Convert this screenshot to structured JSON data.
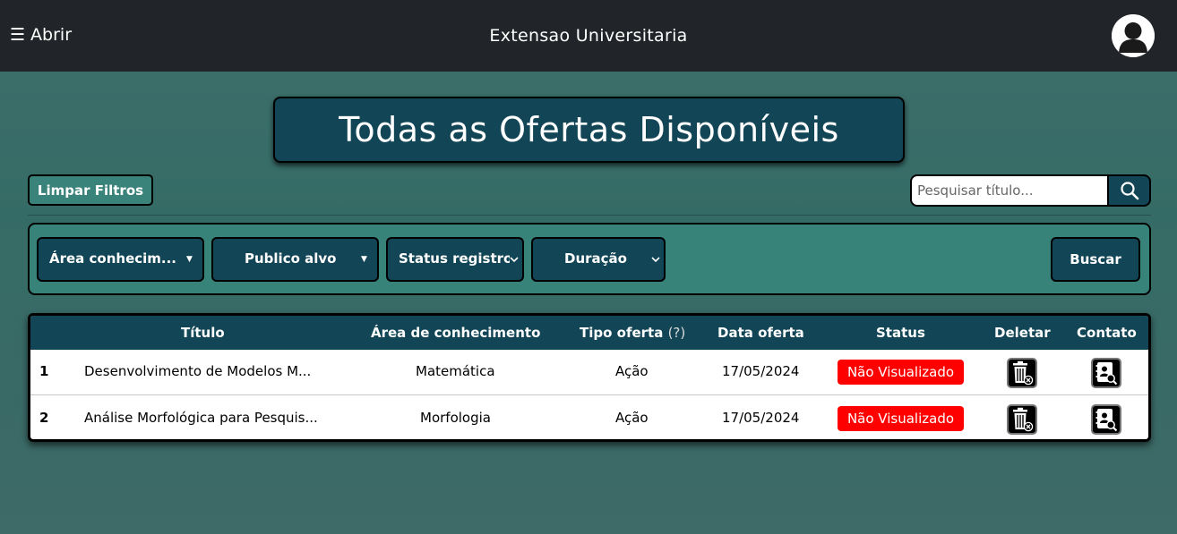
{
  "navbar": {
    "menu_icon": "☰",
    "menu_label": "Abrir",
    "title": "Extensao Universitaria",
    "avatar_icon": "user-silhouette-icon"
  },
  "page": {
    "title": "Todas as Ofertas Disponíveis"
  },
  "toolbar": {
    "clear_filters_label": "Limpar Filtros",
    "search": {
      "placeholder": "Pesquisar título...",
      "value": "",
      "button_icon": "search-icon"
    }
  },
  "filters": {
    "dropdowns": [
      {
        "label": "Área conhecim..."
      },
      {
        "label": "Publico alvo"
      },
      {
        "label": "Status registro"
      },
      {
        "label": "Duração"
      }
    ],
    "search_button_label": "Buscar"
  },
  "table": {
    "headers": {
      "titulo": "Título",
      "area": "Área de conhecimento",
      "tipo": "Tipo oferta",
      "tipo_help": "(?)",
      "data": "Data oferta",
      "status": "Status",
      "deletar": "Deletar",
      "contato": "Contato"
    },
    "rows": [
      {
        "num": "1",
        "titulo": "Desenvolvimento de Modelos M...",
        "area": "Matemática",
        "tipo": "Ação",
        "data": "17/05/2024",
        "status": "Não Visualizado"
      },
      {
        "num": "2",
        "titulo": "Análise Morfológica para Pesquis...",
        "area": "Morfologia",
        "tipo": "Ação",
        "data": "17/05/2024",
        "status": "Não Visualizado"
      }
    ]
  },
  "colors": {
    "navbar_bg": "#212529",
    "page_bg": "#3f6f6b",
    "primary_dark": "#124556",
    "filter_panel": "#37837a",
    "status_unseen": "#ff0000"
  }
}
